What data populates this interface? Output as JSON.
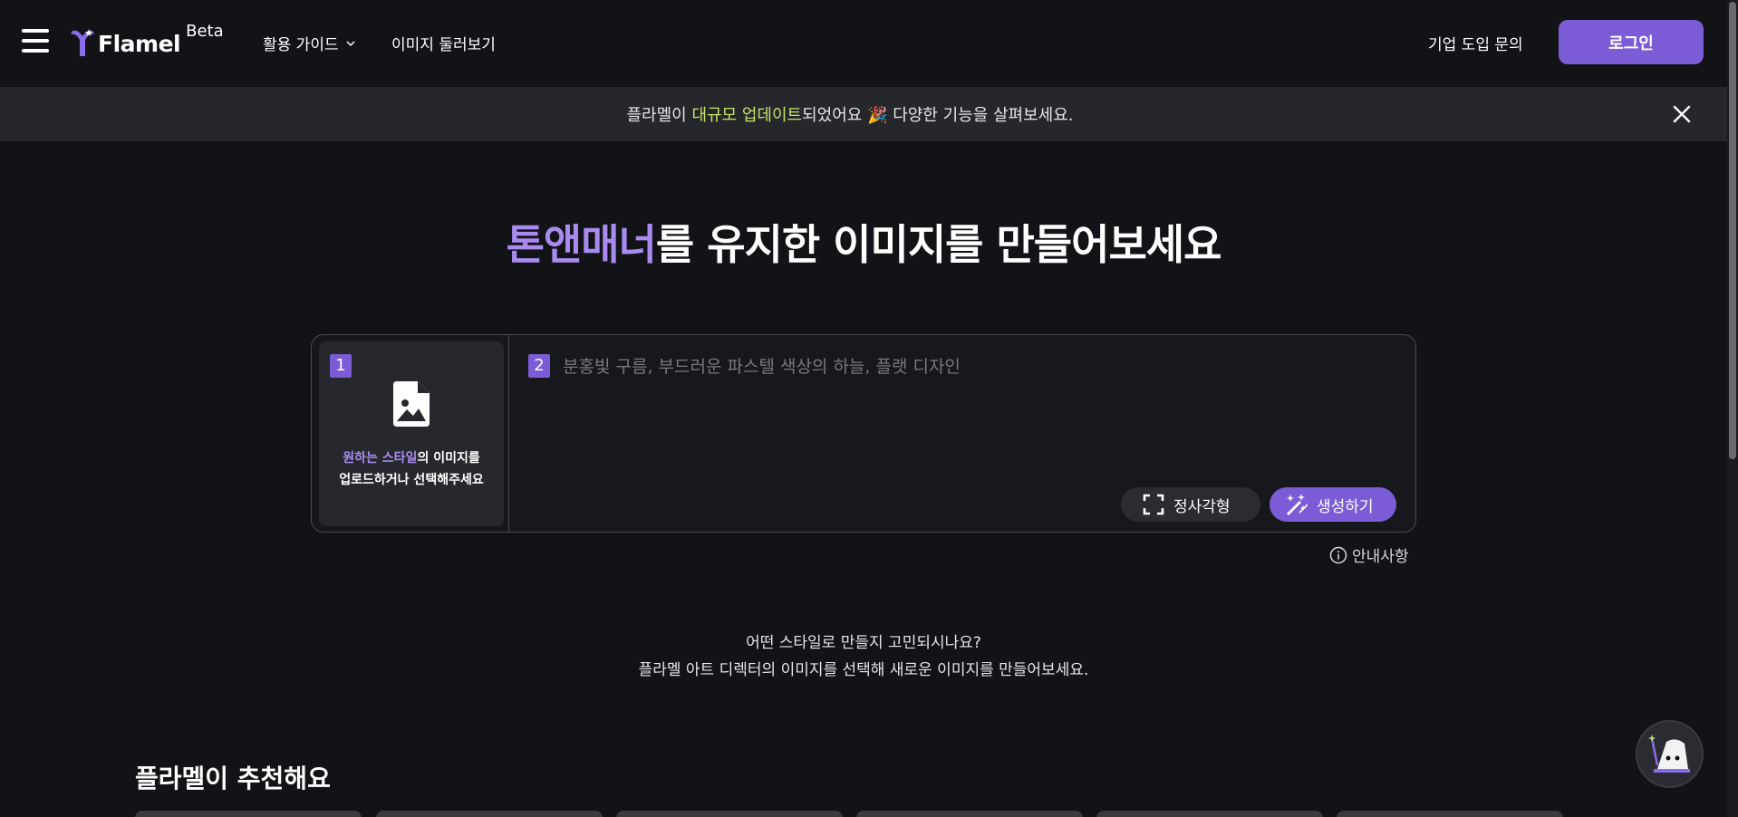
{
  "header": {
    "logo_text": "Flamel",
    "beta": "Beta",
    "nav_guide": "활용 가이드",
    "nav_browse": "이미지 둘러보기",
    "enterprise": "기업 도입 문의",
    "login": "로그인"
  },
  "banner": {
    "prefix": "플라멜이 ",
    "highlight": "대규모 업데이트",
    "suffix": "되었어요 🎉 다양한 기능을 살펴보세요."
  },
  "hero": {
    "accent": "톤앤매너",
    "rest": "를 유지한 이미지를 만들어보세요"
  },
  "card": {
    "step1": "1",
    "step2": "2",
    "upload_accent": "원하는 스타일",
    "upload_rest1": "의 이미지를",
    "upload_line2": "업로드하거나 선택해주세요",
    "prompt_placeholder": "분홍빛 구름, 부드러운 파스텔 색상의 하늘, 플랫 디자인",
    "ratio": "정사각형",
    "generate": "생성하기"
  },
  "notice": "안내사항",
  "helper": {
    "line1": "어떤 스타일로 만들지 고민되시나요?",
    "line2": "플라멜 아트 디렉터의 이미지를 선택해 새로운 이미지를 만들어보세요."
  },
  "section_title": "플라멜이 추천해요",
  "colors": {
    "accent": "#7c5cd6",
    "accent_text": "#a98bf0",
    "highlight": "#c5e46a",
    "background": "#121317"
  }
}
